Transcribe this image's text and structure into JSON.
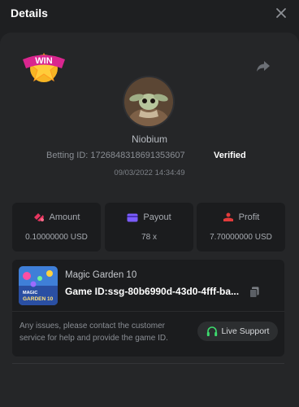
{
  "header": {
    "title": "Details"
  },
  "user": {
    "name": "Niobium",
    "betting_id": "Betting ID: 1726848318691353607",
    "status": "Verified",
    "datetime": "09/03/2022 14:34:49"
  },
  "badge": {
    "text": "WIN"
  },
  "stats": {
    "amount": {
      "label": "Amount",
      "value": "0.10000000 USD"
    },
    "payout": {
      "label": "Payout",
      "value": "78 x"
    },
    "profit": {
      "label": "Profit",
      "value": "7.70000000 USD"
    }
  },
  "game": {
    "name": "Magic Garden 10",
    "id_text": "Game ID:ssg-80b6990d-43d0-4fff-ba...",
    "thumb_line1": "MAGIC",
    "thumb_line2": "GARDEN 10"
  },
  "issues_text": "Any issues, please contact the customer service for help and provide the game ID.",
  "support_label": "Live Support",
  "colors": {
    "accent_pink": "#e8355f",
    "accent_purple": "#7b5cff",
    "accent_red": "#e23b3b",
    "support_green": "#3ddc6e"
  }
}
